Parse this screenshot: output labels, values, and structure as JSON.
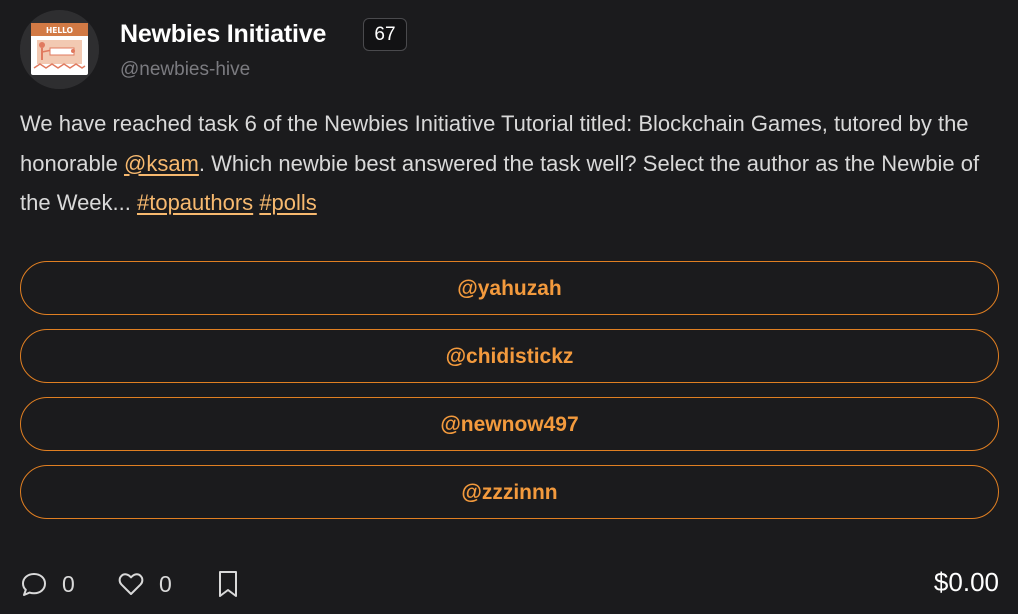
{
  "author": {
    "name": "Newbies Initiative",
    "reputation": "67",
    "handle": "@newbies-hive",
    "avatar_text": "HELLO"
  },
  "post": {
    "text_1": "We have reached task 6 of the Newbies Initiative Tutorial titled: Blockchain Games, tutored by the honorable ",
    "mention": "@ksam",
    "text_2": ". Which newbie best answered the task well? Select the author as the Newbie of the Week... ",
    "tag_1": "#topauthors",
    "tag_2": "#polls"
  },
  "poll": {
    "options": [
      {
        "label": "@yahuzah"
      },
      {
        "label": "@chidistickz"
      },
      {
        "label": "@newnow497"
      },
      {
        "label": "@zzzinnn"
      }
    ]
  },
  "footer": {
    "comments_count": "0",
    "likes_count": "0",
    "payout": "$0.00"
  },
  "colors": {
    "background": "#1b1b1d",
    "accent": "#f39a3d",
    "link": "#f7b96f"
  },
  "icons": {
    "comment": "comment-bubble-icon",
    "like": "heart-icon",
    "bookmark": "bookmark-icon"
  }
}
